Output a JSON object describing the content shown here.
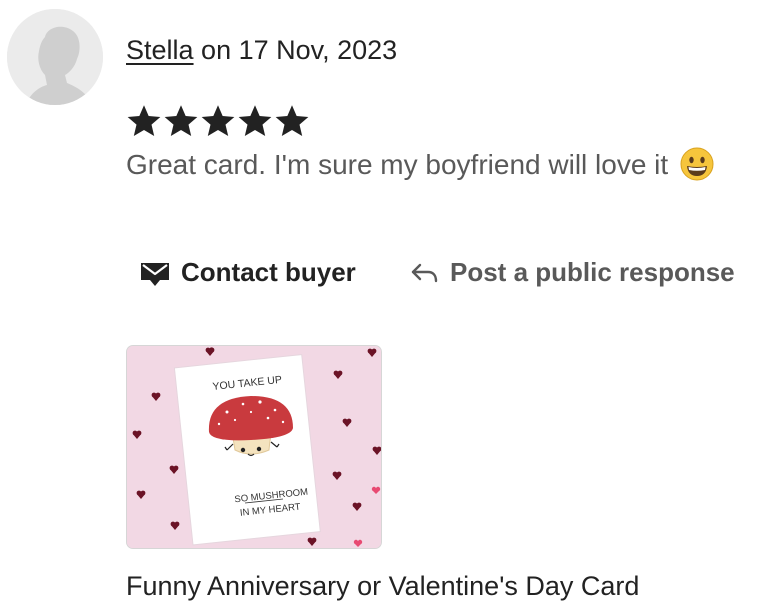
{
  "review": {
    "reviewer_name": "Stella",
    "date_text": " on 17 Nov, 2023",
    "rating": 5,
    "max_rating": 5,
    "text": "Great card. I'm sure my boyfriend will love it",
    "emoji": "grinning-face"
  },
  "actions": {
    "contact_label": "Contact buyer",
    "respond_label": "Post a public response"
  },
  "product": {
    "card_line1": "YOU TAKE UP",
    "card_line2": "SO MUSHROOM",
    "card_line3": "IN MY HEART",
    "title": "Funny Anniversary or Valentine's Day Card"
  },
  "colors": {
    "star": "#222222",
    "text_muted": "#595959",
    "thumb_bg": "#f2d8e4",
    "mushroom_cap": "#c93a3e"
  }
}
